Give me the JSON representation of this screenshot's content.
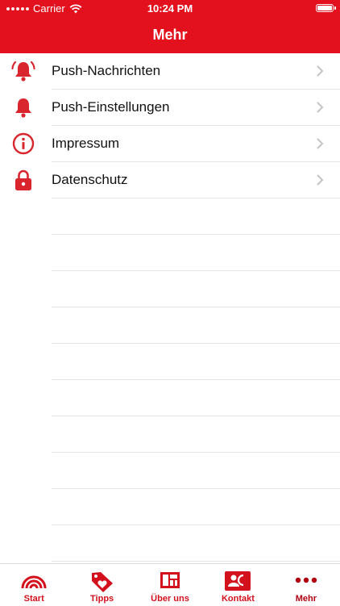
{
  "status_bar": {
    "carrier": "Carrier",
    "time": "10:24 PM"
  },
  "header": {
    "title": "Mehr"
  },
  "menu": {
    "items": [
      {
        "label": "Push-Nachrichten",
        "icon": "bell-ringing-icon"
      },
      {
        "label": "Push-Einstellungen",
        "icon": "bell-icon"
      },
      {
        "label": "Impressum",
        "icon": "info-circle-icon"
      },
      {
        "label": "Datenschutz",
        "icon": "lock-icon"
      }
    ]
  },
  "tabbar": {
    "items": [
      {
        "label": "Start",
        "icon": "rainbow-icon"
      },
      {
        "label": "Tipps",
        "icon": "heart-tag-icon"
      },
      {
        "label": "Über uns",
        "icon": "layout-grid-icon"
      },
      {
        "label": "Kontakt",
        "icon": "contact-card-icon"
      },
      {
        "label": "Mehr",
        "icon": "more-dots-icon"
      }
    ]
  },
  "colors": {
    "accent": "#e3101d",
    "icon_red": "#d9262e",
    "separator": "#e4e4e4"
  }
}
